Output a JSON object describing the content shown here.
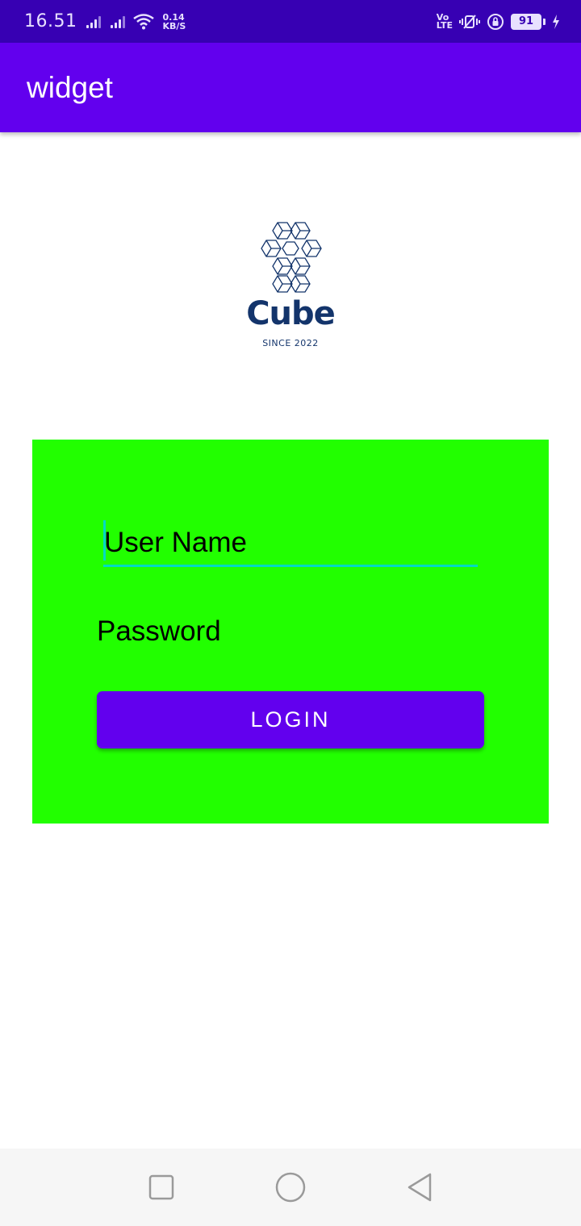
{
  "status_bar": {
    "time": "16.51",
    "net_speed_value": "0.14",
    "net_speed_unit": "KB/S",
    "volte_top": "Vo",
    "volte_bottom": "LTE",
    "battery": "91"
  },
  "app_bar": {
    "title": "widget"
  },
  "logo": {
    "name": "Cube",
    "tagline": "SINCE 2022"
  },
  "form": {
    "username": {
      "placeholder": "User Name"
    },
    "password": {
      "placeholder": "Password"
    },
    "login_label": "LOGIN"
  },
  "colors": {
    "status_bar": "#3700b3",
    "primary": "#6200ee",
    "panel": "#22ff00",
    "accent": "#03dac5",
    "logo": "#13346b"
  },
  "nav": {
    "icons": [
      "recents-icon",
      "home-icon",
      "back-icon"
    ]
  }
}
